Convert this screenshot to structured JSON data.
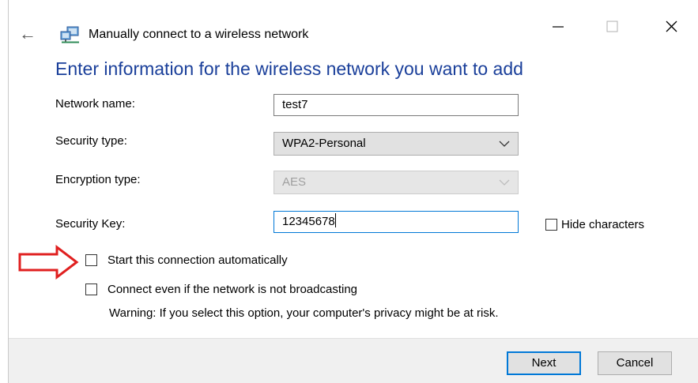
{
  "window": {
    "title": "Manually connect to a wireless network",
    "back_icon": "back-arrow-icon",
    "network_icon": "network-icon",
    "controls": [
      "minimize-icon",
      "maximize-icon",
      "close-icon"
    ]
  },
  "heading": "Enter information for the wireless network you want to add",
  "form": {
    "network_name": {
      "label": "Network name:",
      "value": "test7"
    },
    "security_type": {
      "label": "Security type:",
      "value": "WPA2-Personal"
    },
    "encryption_type": {
      "label": "Encryption type:",
      "value": "AES",
      "disabled": true
    },
    "security_key": {
      "label": "Security Key:",
      "value": "12345678"
    },
    "hide_characters": {
      "label": "Hide characters",
      "checked": false
    }
  },
  "options": {
    "start_automatically": {
      "label": "Start this connection automatically",
      "checked": false
    },
    "connect_not_broadcasting": {
      "label": "Connect even if the network is not broadcasting",
      "checked": false
    },
    "warning": "Warning: If you select this option, your computer's privacy might be at risk."
  },
  "buttons": {
    "next": "Next",
    "cancel": "Cancel"
  },
  "colors": {
    "heading": "#1a3f9a",
    "annotation_arrow": "#e02020",
    "focus": "#0078d7"
  }
}
